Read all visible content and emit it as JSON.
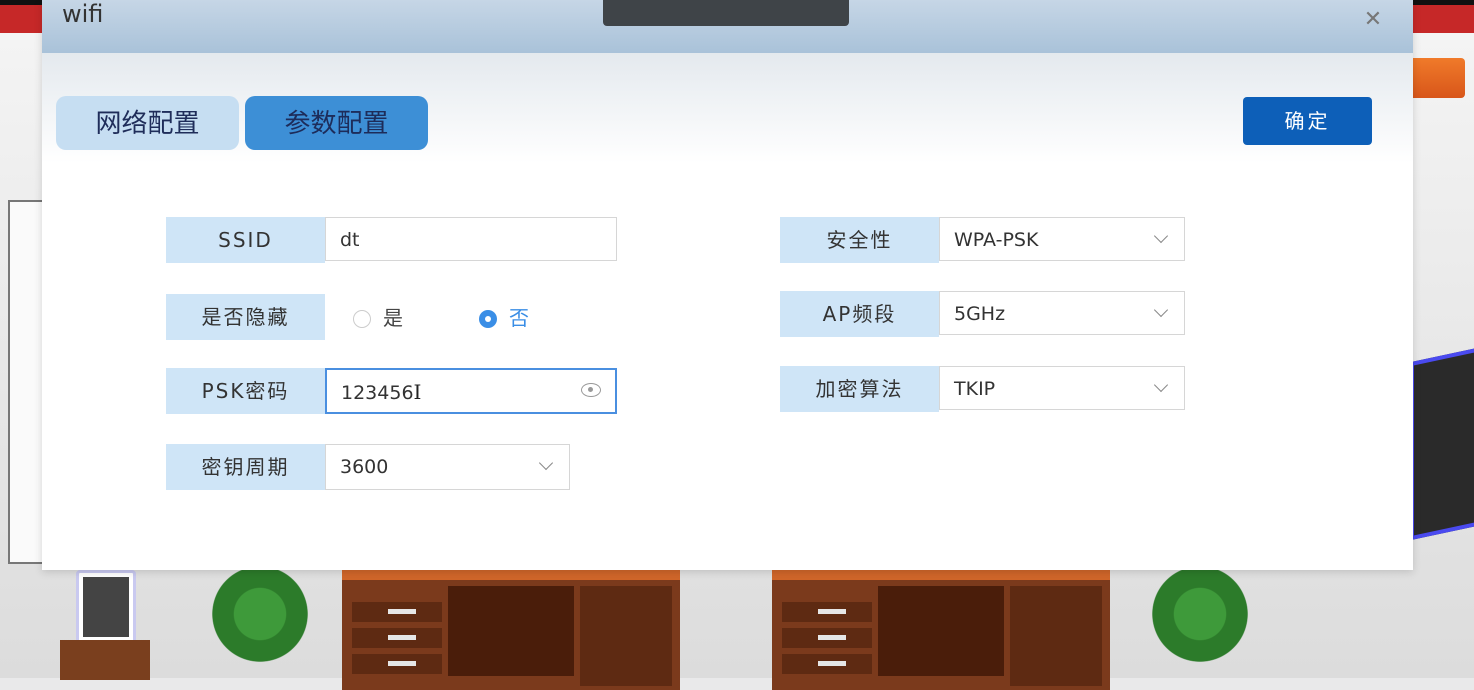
{
  "dialog": {
    "title": "wifi",
    "confirm_label": "确定",
    "tabs": [
      {
        "label": "网络配置",
        "active": false
      },
      {
        "label": "参数配置",
        "active": true
      }
    ]
  },
  "form": {
    "ssid": {
      "label": "SSID",
      "value": "dt"
    },
    "hidden": {
      "label": "是否隐藏",
      "options": [
        "是",
        "否"
      ],
      "selected": "否"
    },
    "psk": {
      "label": "PSK密码",
      "value": "123456"
    },
    "key_period": {
      "label": "密钥周期",
      "value": "3600"
    },
    "security": {
      "label": "安全性",
      "value": "WPA-PSK"
    },
    "ap_band": {
      "label": "AP频段",
      "value": "5GHz"
    },
    "encryption": {
      "label": "加密算法",
      "value": "TKIP"
    }
  },
  "colors": {
    "accent": "#3a8ee6",
    "confirm": "#0d5fb8",
    "label_bg": "#cfe5f7"
  },
  "icons": {
    "close": "close-icon",
    "eye": "eye-icon",
    "chevron": "chevron-down-icon"
  }
}
